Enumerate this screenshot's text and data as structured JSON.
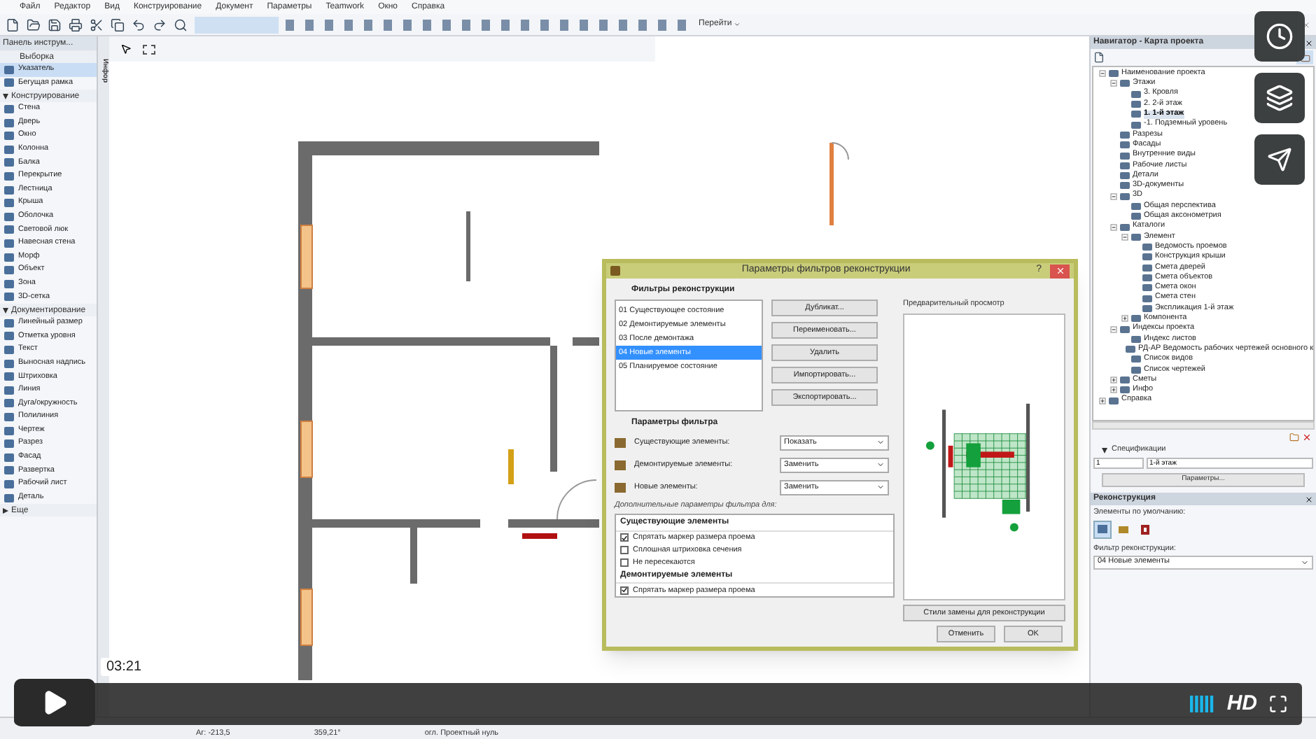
{
  "menu": [
    "Файл",
    "Редактор",
    "Вид",
    "Конструирование",
    "Документ",
    "Параметры",
    "Teamwork",
    "Окно",
    "Справка"
  ],
  "toolbar": {
    "goto_label": "Перейти"
  },
  "toolbox": {
    "title": "Панель инструм...",
    "sections": [
      {
        "kind": "header",
        "title": "Выборка",
        "items": [
          {
            "label": "Указатель",
            "selected": true
          },
          {
            "label": "Бегущая рамка",
            "selected": false
          }
        ]
      },
      {
        "kind": "group",
        "title": "Конструирование",
        "expanded": true,
        "items": [
          {
            "label": "Стена",
            "selected": false
          },
          {
            "label": "Дверь",
            "selected": false
          },
          {
            "label": "Окно",
            "selected": false
          },
          {
            "label": "Колонна",
            "selected": false
          },
          {
            "label": "Балка",
            "selected": false
          },
          {
            "label": "Перекрытие",
            "selected": false
          },
          {
            "label": "Лестница",
            "selected": false
          },
          {
            "label": "Крыша",
            "selected": false
          },
          {
            "label": "Оболочка",
            "selected": false
          },
          {
            "label": "Световой люк",
            "selected": false
          },
          {
            "label": "Навесная стена",
            "selected": false
          },
          {
            "label": "Морф",
            "selected": false
          },
          {
            "label": "Объект",
            "selected": false
          },
          {
            "label": "Зона",
            "selected": false
          },
          {
            "label": "3D-сетка",
            "selected": false
          }
        ]
      },
      {
        "kind": "group",
        "title": "Документирование",
        "expanded": true,
        "items": [
          {
            "label": "Линейный размер",
            "selected": false
          },
          {
            "label": "Отметка уровня",
            "selected": false
          },
          {
            "label": "Текст",
            "selected": false
          },
          {
            "label": "Выносная надпись",
            "selected": false
          },
          {
            "label": "Штриховка",
            "selected": false
          },
          {
            "label": "Линия",
            "selected": false
          },
          {
            "label": "Дуга/окружность",
            "selected": false
          },
          {
            "label": "Полилиния",
            "selected": false
          },
          {
            "label": "Чертеж",
            "selected": false
          },
          {
            "label": "Разрез",
            "selected": false
          },
          {
            "label": "Фасад",
            "selected": false
          },
          {
            "label": "Развертка",
            "selected": false
          },
          {
            "label": "Рабочий лист",
            "selected": false
          },
          {
            "label": "Деталь",
            "selected": false
          }
        ]
      },
      {
        "kind": "group",
        "title": "Еще",
        "expanded": false
      }
    ]
  },
  "canvas": {
    "info_tab": "Инфор"
  },
  "dialog": {
    "title": "Параметры фильтров реконструкции",
    "help": "?",
    "filters_heading": "Фильтры реконструкции",
    "filters": [
      {
        "label": "01 Существующее состояние",
        "selected": false
      },
      {
        "label": "02 Демонтируемые элементы",
        "selected": false
      },
      {
        "label": "03 После демонтажа",
        "selected": false
      },
      {
        "label": "04 Новые элементы",
        "selected": true
      },
      {
        "label": "05 Планируемое состояние",
        "selected": false
      }
    ],
    "buttons": [
      "Дубликат...",
      "Переименовать...",
      "Удалить",
      "Импортировать...",
      "Экспортировать..."
    ],
    "params_heading": "Параметры фильтра",
    "params": [
      {
        "label": "Существующие элементы:",
        "value": "Показать"
      },
      {
        "label": "Демонтируемые элементы:",
        "value": "Заменить"
      },
      {
        "label": "Новые элементы:",
        "value": "Заменить"
      }
    ],
    "extra_label": "Дополнительные параметры фильтра для:",
    "extra": [
      {
        "kind": "heading",
        "label": "Существующие элементы"
      },
      {
        "kind": "check",
        "label": "Спрятать маркер размера проема",
        "checked": true
      },
      {
        "kind": "check",
        "label": "Сплошная штриховка сечения",
        "checked": false
      },
      {
        "kind": "check",
        "label": "Не пересекаются",
        "checked": false
      },
      {
        "kind": "heading",
        "label": "Демонтируемые элементы"
      },
      {
        "kind": "check",
        "label": "Спрятать маркер размера проема",
        "checked": true
      }
    ],
    "preview_label": "Предварительный просмотр",
    "styles_button": "Стили замены для реконструкции",
    "cancel": "Отменить",
    "ok": "OK"
  },
  "navigator": {
    "title": "Навигатор - Карта проекта",
    "tree": [
      {
        "label": "Наименование проекта",
        "selected": false,
        "expanded": true,
        "children": [
          {
            "label": "Этажи",
            "selected": false,
            "expanded": true,
            "children": [
              {
                "label": "3. Кровля",
                "selected": false
              },
              {
                "label": "2. 2-й этаж",
                "selected": false
              },
              {
                "label": "1. 1-й этаж",
                "selected": true
              },
              {
                "label": "-1. Подземный уровень",
                "selected": false
              }
            ]
          },
          {
            "label": "Разрезы",
            "selected": false
          },
          {
            "label": "Фасады",
            "selected": false
          },
          {
            "label": "Внутренние виды",
            "selected": false
          },
          {
            "label": "Рабочие листы",
            "selected": false
          },
          {
            "label": "Детали",
            "selected": false
          },
          {
            "label": "3D-документы",
            "selected": false
          },
          {
            "label": "3D",
            "selected": false,
            "expanded": true,
            "children": [
              {
                "label": "Общая перспектива",
                "selected": false
              },
              {
                "label": "Общая аксонометрия",
                "selected": false
              }
            ]
          },
          {
            "label": "Каталоги",
            "selected": false,
            "expanded": true,
            "children": [
              {
                "label": "Элемент",
                "selected": false,
                "expanded": true,
                "children": [
                  {
                    "label": "Ведомость проемов",
                    "selected": false
                  },
                  {
                    "label": "Конструкция крыши",
                    "selected": false
                  },
                  {
                    "label": "Смета дверей",
                    "selected": false
                  },
                  {
                    "label": "Смета объектов",
                    "selected": false
                  },
                  {
                    "label": "Смета окон",
                    "selected": false
                  },
                  {
                    "label": "Смета стен",
                    "selected": false
                  },
                  {
                    "label": "Экспликация 1-й этаж",
                    "selected": false
                  }
                ]
              },
              {
                "label": "Компонента",
                "selected": false,
                "expanded": false
              }
            ]
          },
          {
            "label": "Индексы проекта",
            "selected": false,
            "expanded": true,
            "children": [
              {
                "label": "Индекс листов",
                "selected": false
              },
              {
                "label": "РД-АР Ведомость рабочих чертежей основного к",
                "selected": false
              },
              {
                "label": "Список видов",
                "selected": false
              },
              {
                "label": "Список чертежей",
                "selected": false
              }
            ]
          },
          {
            "label": "Сметы",
            "selected": false,
            "expanded": false
          },
          {
            "label": "Инфо",
            "selected": false,
            "expanded": false
          }
        ]
      },
      {
        "label": "Справка",
        "selected": false,
        "expanded": false
      }
    ],
    "specs_label": "Спецификации",
    "specs_number": "1",
    "specs_name": "1-й этаж",
    "params_button": "Параметры..."
  },
  "reconstruction": {
    "title": "Реконструкция",
    "defaults_label": "Элементы по умолчанию:",
    "modes": [
      {
        "selected": true
      },
      {
        "selected": false
      },
      {
        "selected": false
      }
    ],
    "filter_label": "Фильтр реконструкции:",
    "filter_value": "04 Новые элементы"
  },
  "status_bar": [
    "Аг: -213,5",
    "359,21°",
    "огл. Проектный нуль"
  ],
  "player": {
    "time": "03:21",
    "hd": "HD"
  }
}
